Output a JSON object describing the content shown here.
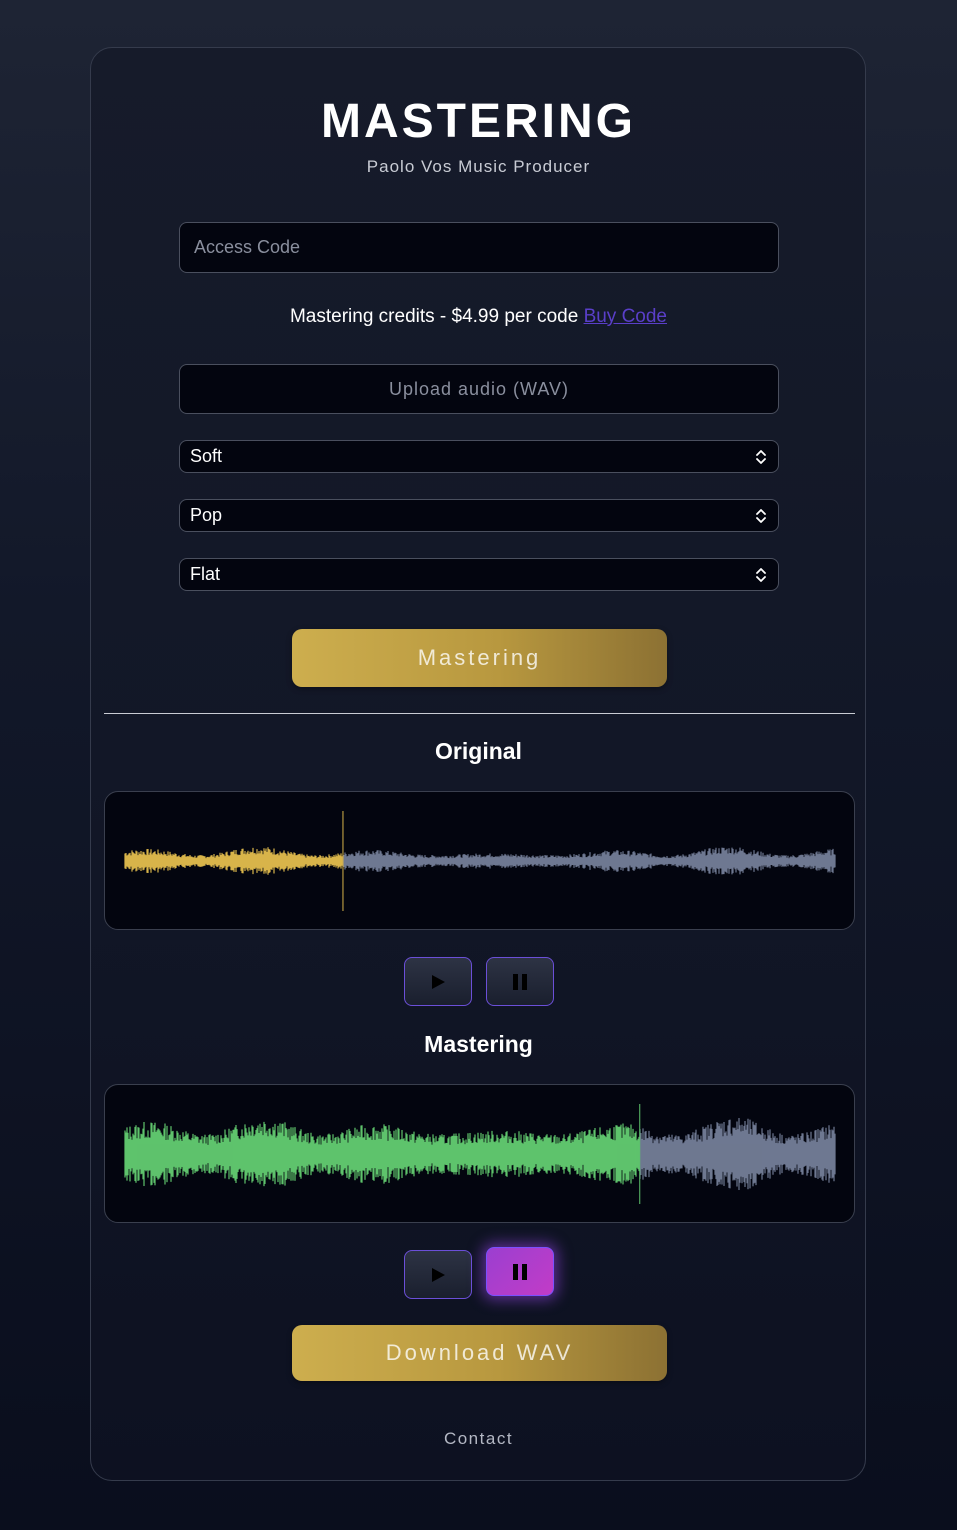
{
  "header": {
    "title": "MASTERING",
    "subtitle": "Paolo Vos Music Producer"
  },
  "access": {
    "placeholder": "Access Code",
    "value": ""
  },
  "credits": {
    "text": "Mastering credits - $4.99 per code",
    "link_label": "Buy Code"
  },
  "upload": {
    "label": "Upload audio (WAV)"
  },
  "selects": [
    {
      "value": "Soft"
    },
    {
      "value": "Pop"
    },
    {
      "value": "Flat"
    }
  ],
  "master_button": {
    "label": "Mastering"
  },
  "original": {
    "label": "Original",
    "progress": 0.307,
    "played_color": "#d8b44a",
    "unplayed_color": "#6e7891"
  },
  "mastered": {
    "label": "Mastering",
    "progress": 0.725,
    "played_color": "#5ec36c",
    "unplayed_color": "#6e7891"
  },
  "icons": {
    "play": "play-icon",
    "pause": "pause-icon",
    "select_arrow": "updown-chevron-icon"
  },
  "download_button": {
    "label": "Download WAV"
  },
  "footer": {
    "contact_label": "Contact"
  },
  "colors": {
    "accent_gold": "#c9a94b",
    "link_purple": "#5a3fc9",
    "active_pause": "#b13ccb"
  }
}
